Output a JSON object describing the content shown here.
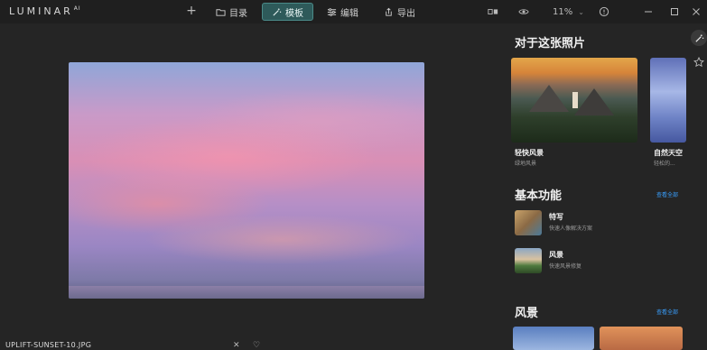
{
  "app": {
    "logo": "LUMINAR",
    "logo_sup": "AI"
  },
  "toolbar": {
    "add_label": "+",
    "catalog_label": "目录",
    "templates_label": "模板",
    "edit_label": "编辑",
    "export_label": "导出",
    "zoom_value": "11%",
    "zoom_caret": "⌄"
  },
  "canvas": {
    "filename": "UPLIFT-SUNSET-10.JPG"
  },
  "panel": {
    "photo_section_title": "对于这张照片",
    "photo_cards": [
      {
        "title": "轻快风景",
        "subtitle": "绿地风景"
      },
      {
        "title": "自然天空",
        "subtitle": "轻松的..."
      }
    ],
    "essentials_title": "基本功能",
    "essentials_see_all": "查看全部",
    "essentials": [
      {
        "title": "特写",
        "subtitle": "快速人像解决方案"
      },
      {
        "title": "风景",
        "subtitle": "快速风景修复"
      }
    ],
    "landscape_title": "风景",
    "landscape_see_all": "查看全部"
  },
  "colors": {
    "accent": "#2e5a5a",
    "link": "#3aa0ff",
    "background": "#252525"
  }
}
